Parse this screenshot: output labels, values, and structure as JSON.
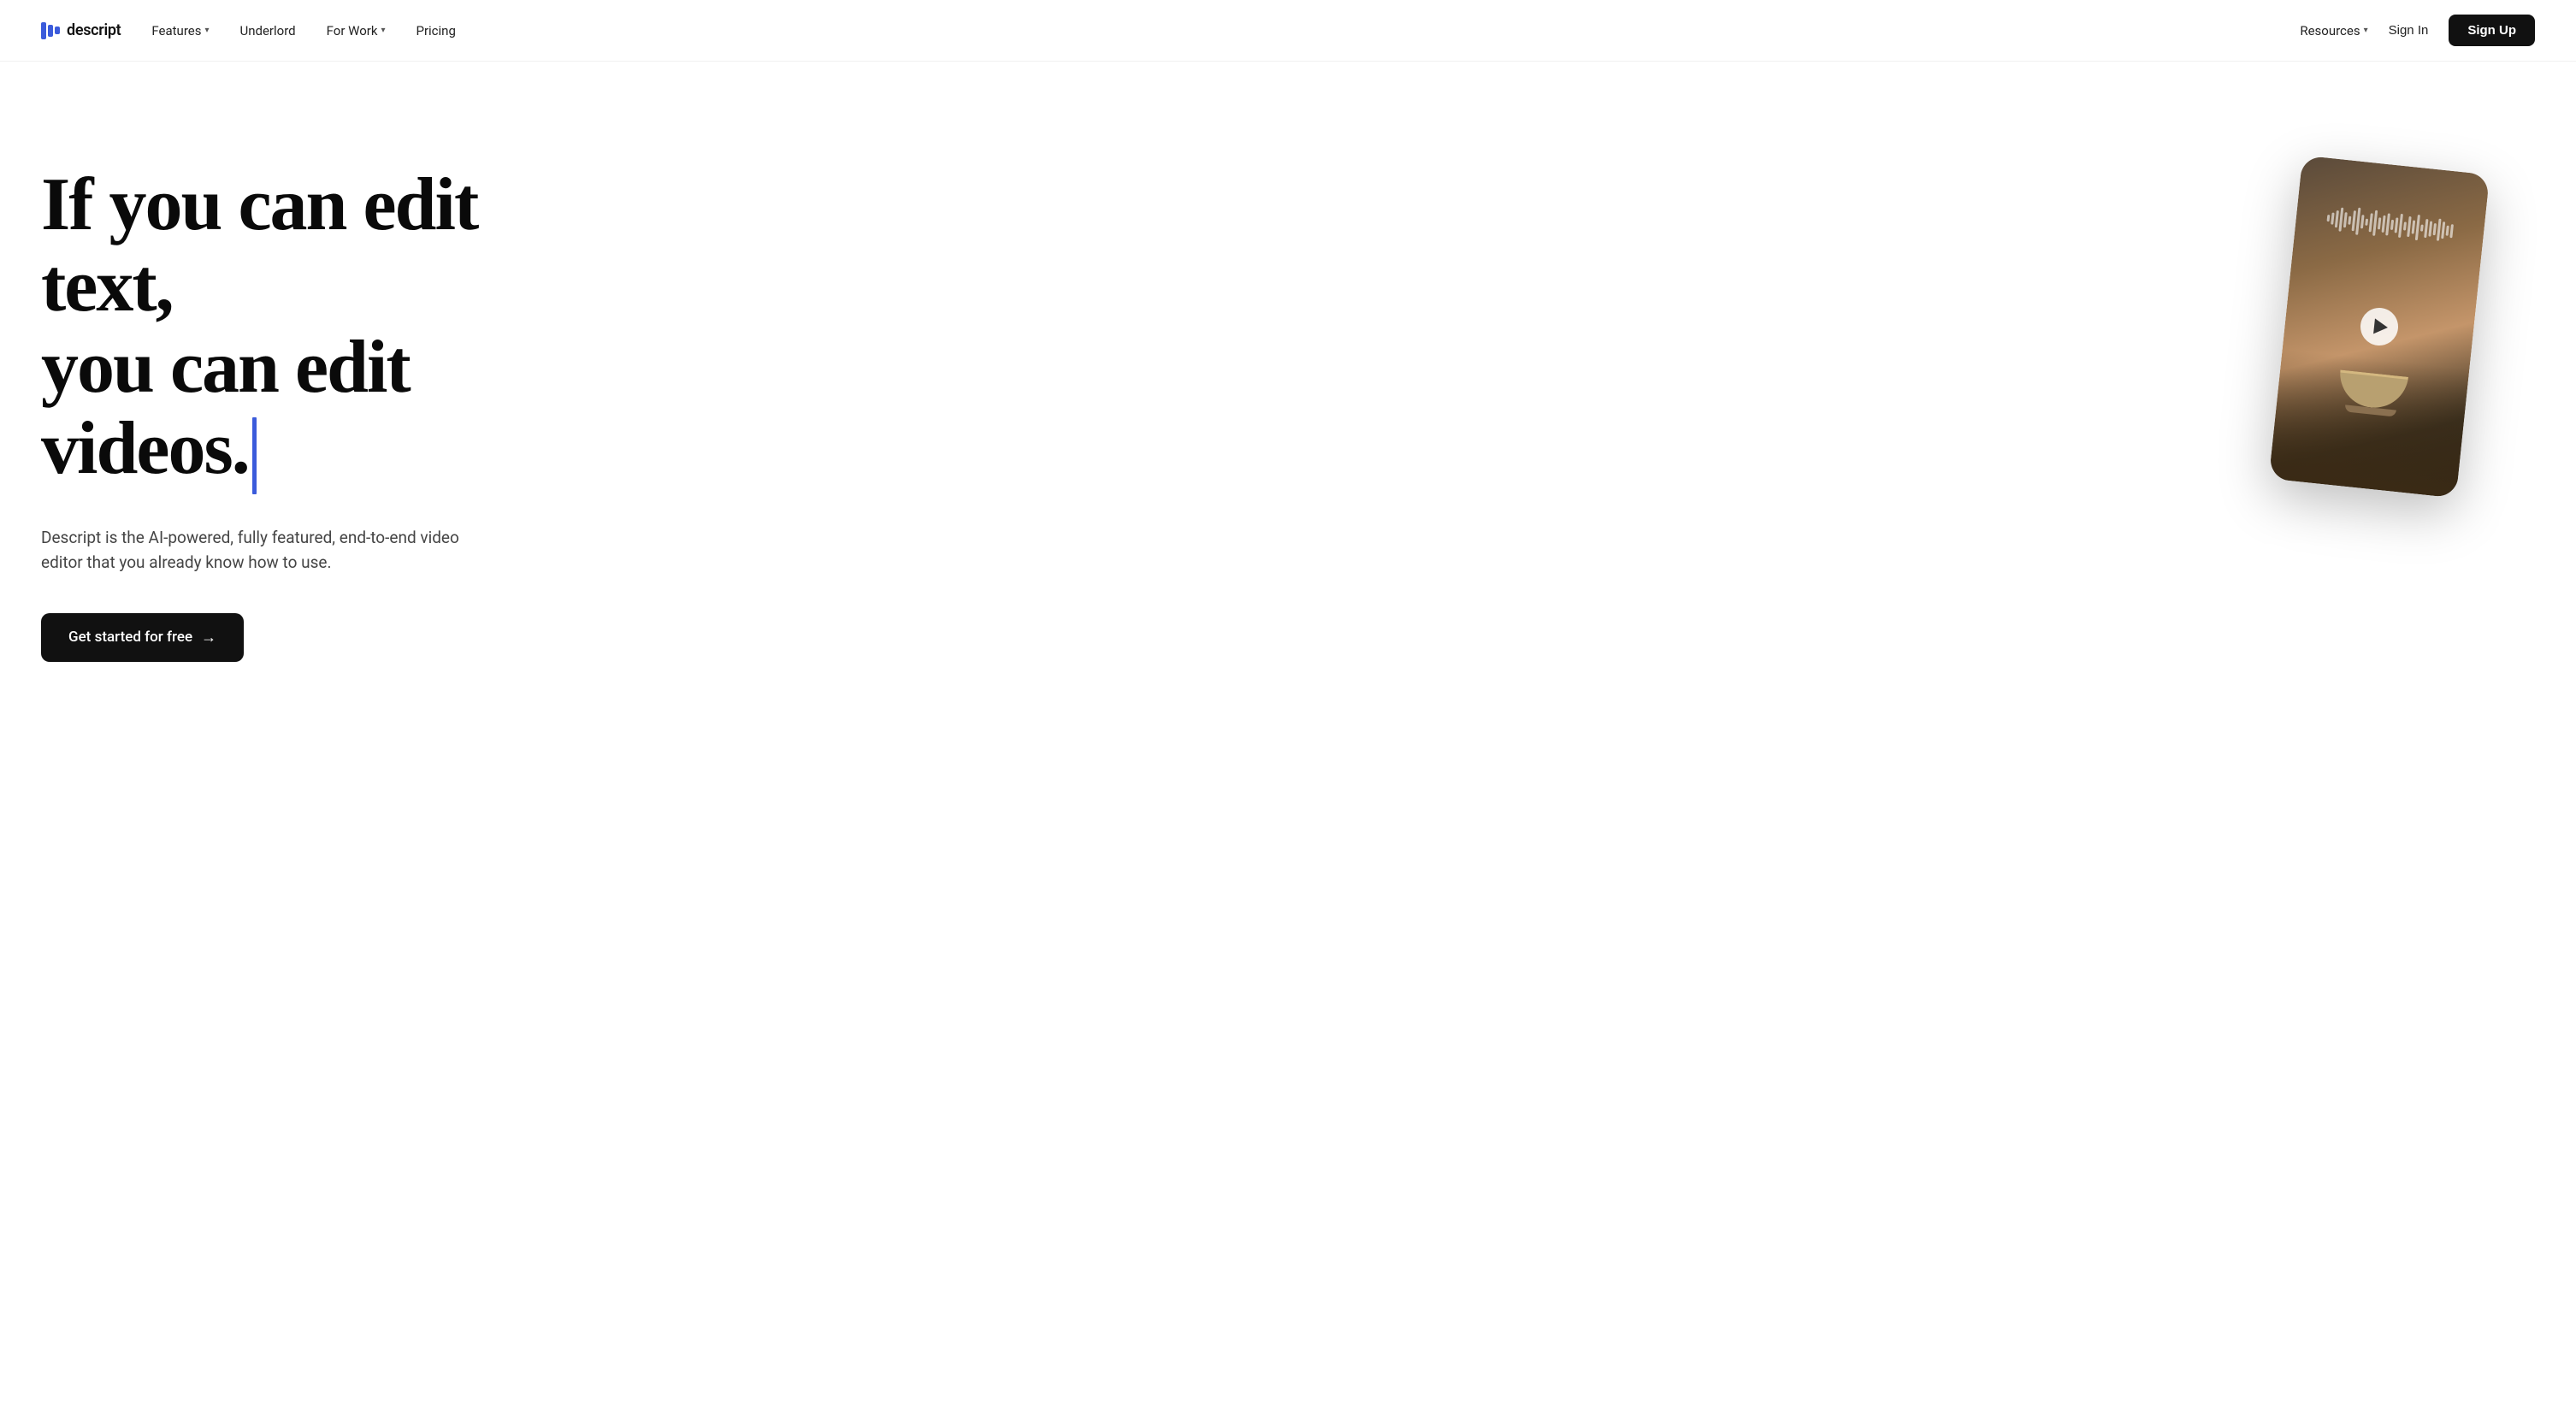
{
  "logo": {
    "text": "descript",
    "alt": "Descript logo"
  },
  "nav": {
    "left_links": [
      {
        "id": "features",
        "label": "Features",
        "has_dropdown": true
      },
      {
        "id": "underlord",
        "label": "Underlord",
        "has_dropdown": false
      },
      {
        "id": "for-work",
        "label": "For Work",
        "has_dropdown": true
      },
      {
        "id": "pricing",
        "label": "Pricing",
        "has_dropdown": false
      }
    ],
    "right_links": [
      {
        "id": "resources",
        "label": "Resources",
        "has_dropdown": true
      }
    ],
    "sign_in_label": "Sign In",
    "sign_up_label": "Sign Up"
  },
  "hero": {
    "headline_line1": "If you can edit text,",
    "headline_line2": "you can edit videos.",
    "subtext": "Descript is the AI-powered, fully featured, end-to-end video editor that you already know how to use.",
    "cta_label": "Get started for free",
    "cta_arrow": "→",
    "cursor_color": "#3b5bdb"
  },
  "colors": {
    "accent": "#3b5bdb",
    "cta_bg": "#111111",
    "nav_signup_bg": "#111111"
  },
  "wave_bars": [
    8,
    14,
    20,
    28,
    18,
    10,
    24,
    32,
    16,
    8,
    22,
    30,
    14,
    20,
    26,
    12,
    18,
    28,
    10,
    24,
    16,
    30,
    8,
    22,
    18,
    14,
    26,
    20,
    12,
    16
  ]
}
